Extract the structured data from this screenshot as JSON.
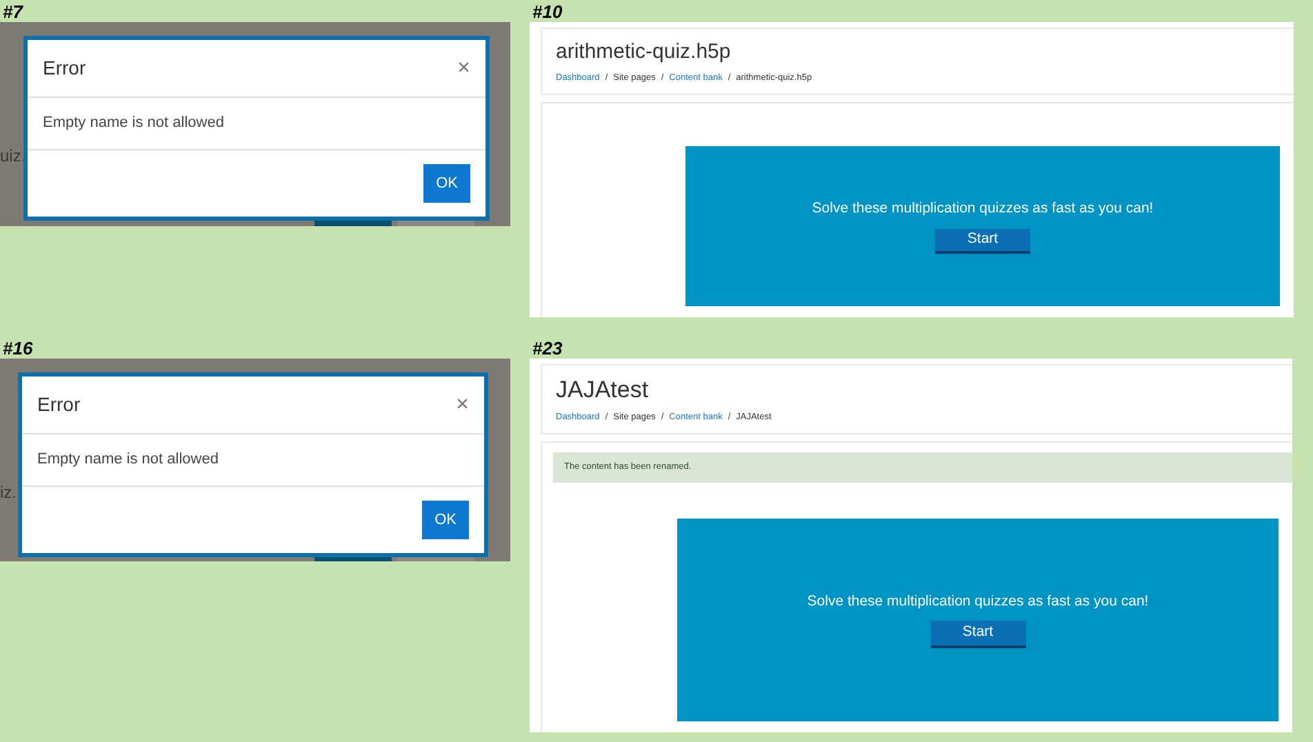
{
  "panels": [
    {
      "kind": "dialog",
      "label": "#7",
      "behind": {
        "text": "uiz."
      },
      "dialog": {
        "title": "Error",
        "close": "×",
        "message": "Empty name is not allowed",
        "ok": "OK"
      }
    },
    {
      "kind": "page",
      "label": "#10",
      "title": "arithmetic-quiz.h5p",
      "breadcrumb": [
        {
          "text": "Dashboard",
          "link": true
        },
        {
          "text": "Site pages",
          "link": false
        },
        {
          "text": "Content bank",
          "link": true
        },
        {
          "text": "arithmetic-quiz.h5p",
          "link": false
        }
      ],
      "separator": "/",
      "h5p": {
        "intro": "Solve these multiplication quizzes as fast as you can!",
        "button": "Start"
      }
    },
    {
      "kind": "dialog",
      "label": "#16",
      "behind": {
        "text": "iz."
      },
      "dialog": {
        "title": "Error",
        "close": "×",
        "message": "Empty name is not allowed",
        "ok": "OK"
      }
    },
    {
      "kind": "page",
      "label": "#23",
      "title": "JAJAtest",
      "breadcrumb": [
        {
          "text": "Dashboard",
          "link": true
        },
        {
          "text": "Site pages",
          "link": false
        },
        {
          "text": "Content bank",
          "link": true
        },
        {
          "text": "JAJAtest",
          "link": false
        }
      ],
      "separator": "/",
      "alert": "The content has been renamed.",
      "h5p": {
        "intro": "Solve these multiplication quizzes as fast as you can!",
        "button": "Start"
      }
    }
  ]
}
